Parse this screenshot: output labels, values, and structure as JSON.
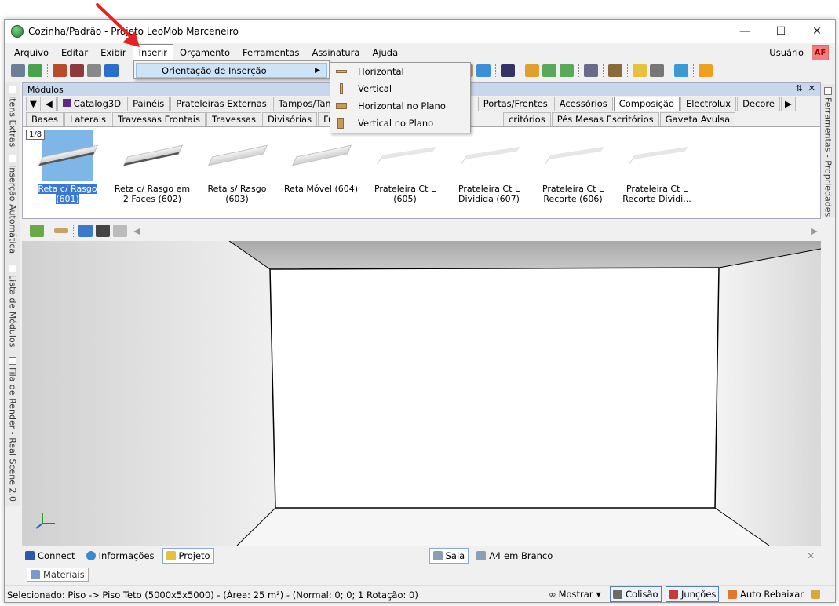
{
  "window": {
    "title": "Cozinha/Padrão - Projeto LeoMob Marceneiro"
  },
  "menu": {
    "items": [
      "Arquivo",
      "Editar",
      "Exibir",
      "Inserir",
      "Orçamento",
      "Ferramentas",
      "Assinatura",
      "Ajuda"
    ],
    "active": "Inserir",
    "user_label": "Usuário",
    "user_badge": "AF"
  },
  "dropdown": {
    "item": "Orientação de Inserção"
  },
  "submenu": {
    "items": [
      "Horizontal",
      "Vertical",
      "Horizontal no Plano",
      "Vertical no Plano"
    ]
  },
  "left_panel_tabs": [
    "Itens Extras",
    "Inserção Automática",
    "Lista de Módulos",
    "Fila de Render - Real Scene 2.0"
  ],
  "right_panel_tabs": [
    "Ferramentas - Propriedades"
  ],
  "modules_panel": {
    "title": "Módulos",
    "category_tabs": [
      "Catalog3D",
      "Painéis",
      "Prateleiras Externas",
      "Tampos/Tamp",
      "Portas/Frentes",
      "Acessórios",
      "Composição",
      "Electrolux",
      "Decore"
    ],
    "selected_category": "Composição",
    "sub_tabs": [
      "Bases",
      "Laterais",
      "Travessas Frontais",
      "Travessas",
      "Divisórias",
      "Fundos",
      "critórios",
      "Pés Mesas Escritórios",
      "Gaveta Avulsa"
    ],
    "page_indicator": "1/8",
    "items": [
      {
        "label": "Reta c/ Rasgo (601)"
      },
      {
        "label": "Reta c/ Rasgo em 2 Faces (602)"
      },
      {
        "label": "Reta s/ Rasgo (603)"
      },
      {
        "label": "Reta Móvel (604)"
      },
      {
        "label": "Prateleira Ct L (605)"
      },
      {
        "label": "Prateleira Ct L Dividida (607)"
      },
      {
        "label": "Prateleira Ct L Recorte (606)"
      },
      {
        "label": "Prateleira Ct L Recorte Dividi..."
      }
    ]
  },
  "bottom_tabs": {
    "left": [
      "Connect",
      "Informações",
      "Projeto"
    ],
    "selected_left": "Projeto",
    "right": [
      "Sala",
      "A4 em Branco"
    ],
    "selected_right": "Sala"
  },
  "materials_tab": "Materiais",
  "status": {
    "text": "Selecionado: Piso -> Piso Teto (5000x5x5000) - (Área: 25 m²) - (Normal: 0; 0; 1 Rotação: 0)",
    "mostrar": "Mostrar",
    "colisao": "Colisão",
    "juncoes": "Junções",
    "auto_rebaixar": "Auto Rebaixar"
  }
}
